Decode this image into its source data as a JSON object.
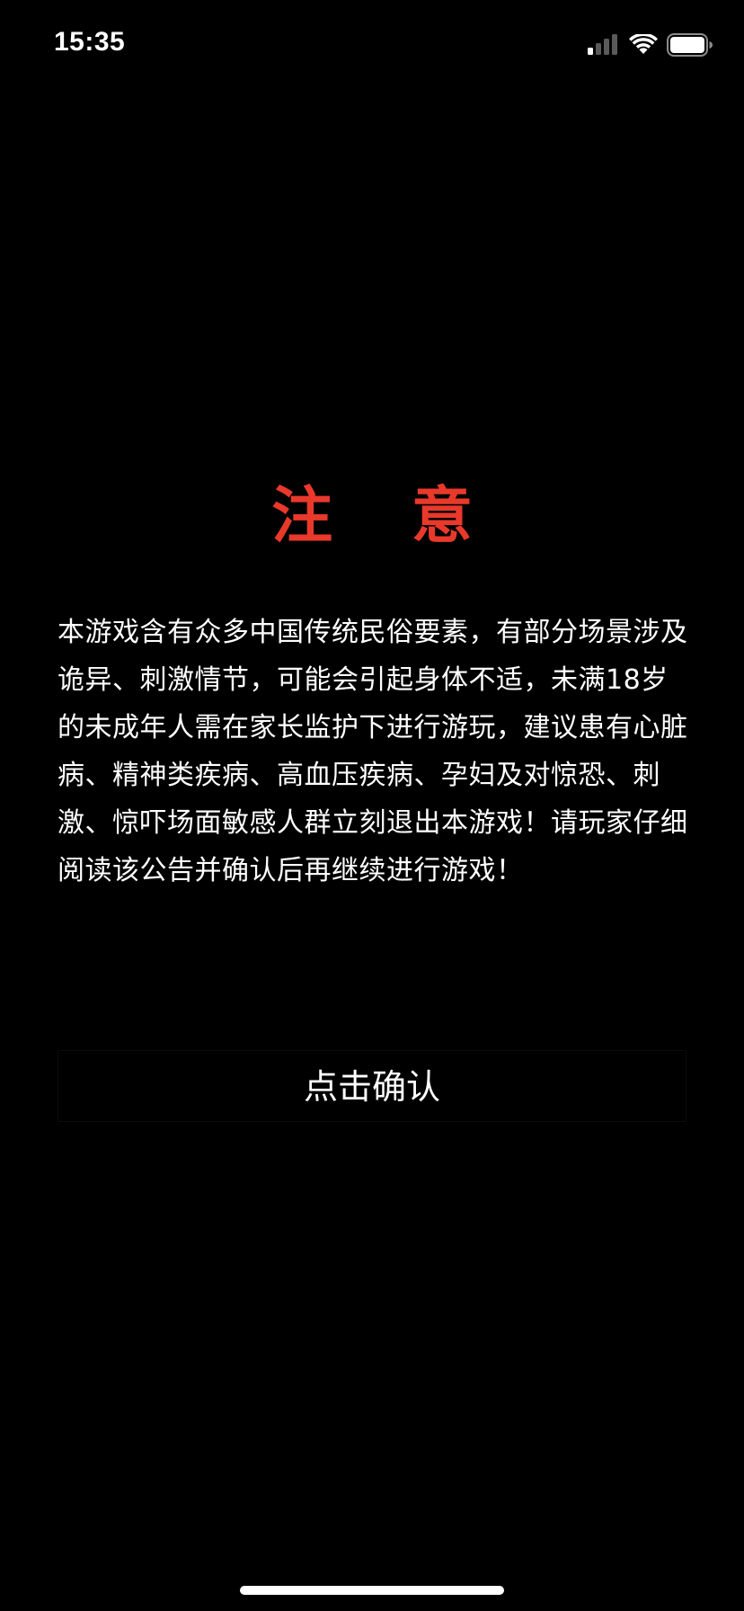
{
  "status_bar": {
    "time": "15:35",
    "signal_icon": "cellular-signal-icon",
    "wifi_icon": "wifi-icon",
    "battery_icon": "battery-icon"
  },
  "notice": {
    "title": "注 意",
    "body": "本游戏含有众多中国传统民俗要素，有部分场景涉及诡异、刺激情节，可能会引起身体不适，未满18岁的未成年人需在家长监护下进行游玩，建议患有心脏病、精神类疾病、高血压疾病、孕妇及对惊恐、刺激、惊吓场面敏感人群立刻退出本游戏！请玩家仔细阅读该公告并确认后再继续进行游戏！",
    "confirm_label": "点击确认"
  },
  "colors": {
    "background": "#000000",
    "title": "#e8392b",
    "text": "#ffffff"
  }
}
